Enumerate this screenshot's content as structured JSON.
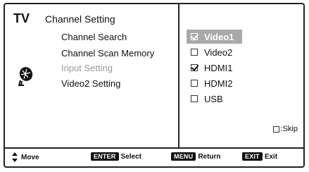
{
  "header": {
    "tv_label": "TV",
    "menu_title": "Channel Setting"
  },
  "menu": {
    "items": [
      {
        "label": "Channel Search",
        "enabled": true
      },
      {
        "label": "Channel Scan Memory",
        "enabled": true
      },
      {
        "label": "Input Setting",
        "enabled": false
      },
      {
        "label": "Video2 Setting",
        "enabled": true
      }
    ],
    "icon": "satellite-dish-icon"
  },
  "sources": [
    {
      "label": "Video1",
      "checked": true,
      "selected": true
    },
    {
      "label": "Video2",
      "checked": false,
      "selected": false
    },
    {
      "label": "HDMI1",
      "checked": true,
      "selected": false
    },
    {
      "label": "HDMI2",
      "checked": false,
      "selected": false
    },
    {
      "label": "USB",
      "checked": false,
      "selected": false
    }
  ],
  "legend": {
    "skip_label": ":Skip"
  },
  "footer": {
    "move_label": "Move",
    "enter_key": "ENTER",
    "enter_label": "Select",
    "menu_key": "MENU",
    "menu_label": "Return",
    "exit_key": "EXIT",
    "exit_label": "Exit"
  },
  "colors": {
    "selection_bg": "#a9a9a9",
    "frame": "#222222",
    "disabled_text": "#9a9a9a"
  }
}
